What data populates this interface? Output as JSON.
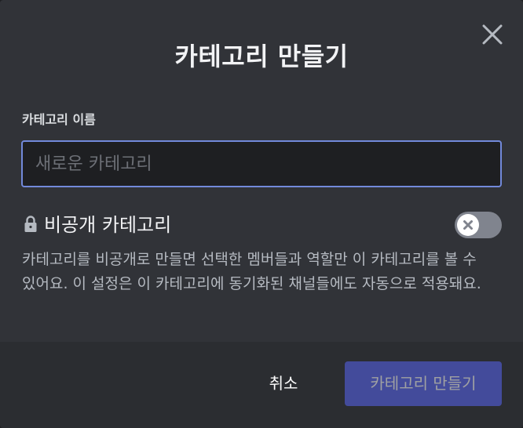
{
  "dialog": {
    "title": "카테고리 만들기",
    "close_icon": "close-icon"
  },
  "category_name": {
    "label": "카테고리 이름",
    "value": "",
    "placeholder": "새로운 카테고리"
  },
  "private": {
    "icon": "lock-icon",
    "label": "비공개 카테고리",
    "toggle_state": "off",
    "description": "카테고리를 비공개로 만들면 선택한 멤버들과 역할만 이 카테고리를 볼 수 있어요. 이 설정은 이 카테고리에 동기화된 채널들에도 자동으로 적용돼요."
  },
  "footer": {
    "cancel_label": "취소",
    "create_label": "카테고리 만들기",
    "create_enabled": false
  },
  "colors": {
    "background": "#313338",
    "footer": "#2b2d31",
    "input_border_focus": "#7289da",
    "primary_button": "#5865f2",
    "toggle_off": "#80848e"
  }
}
